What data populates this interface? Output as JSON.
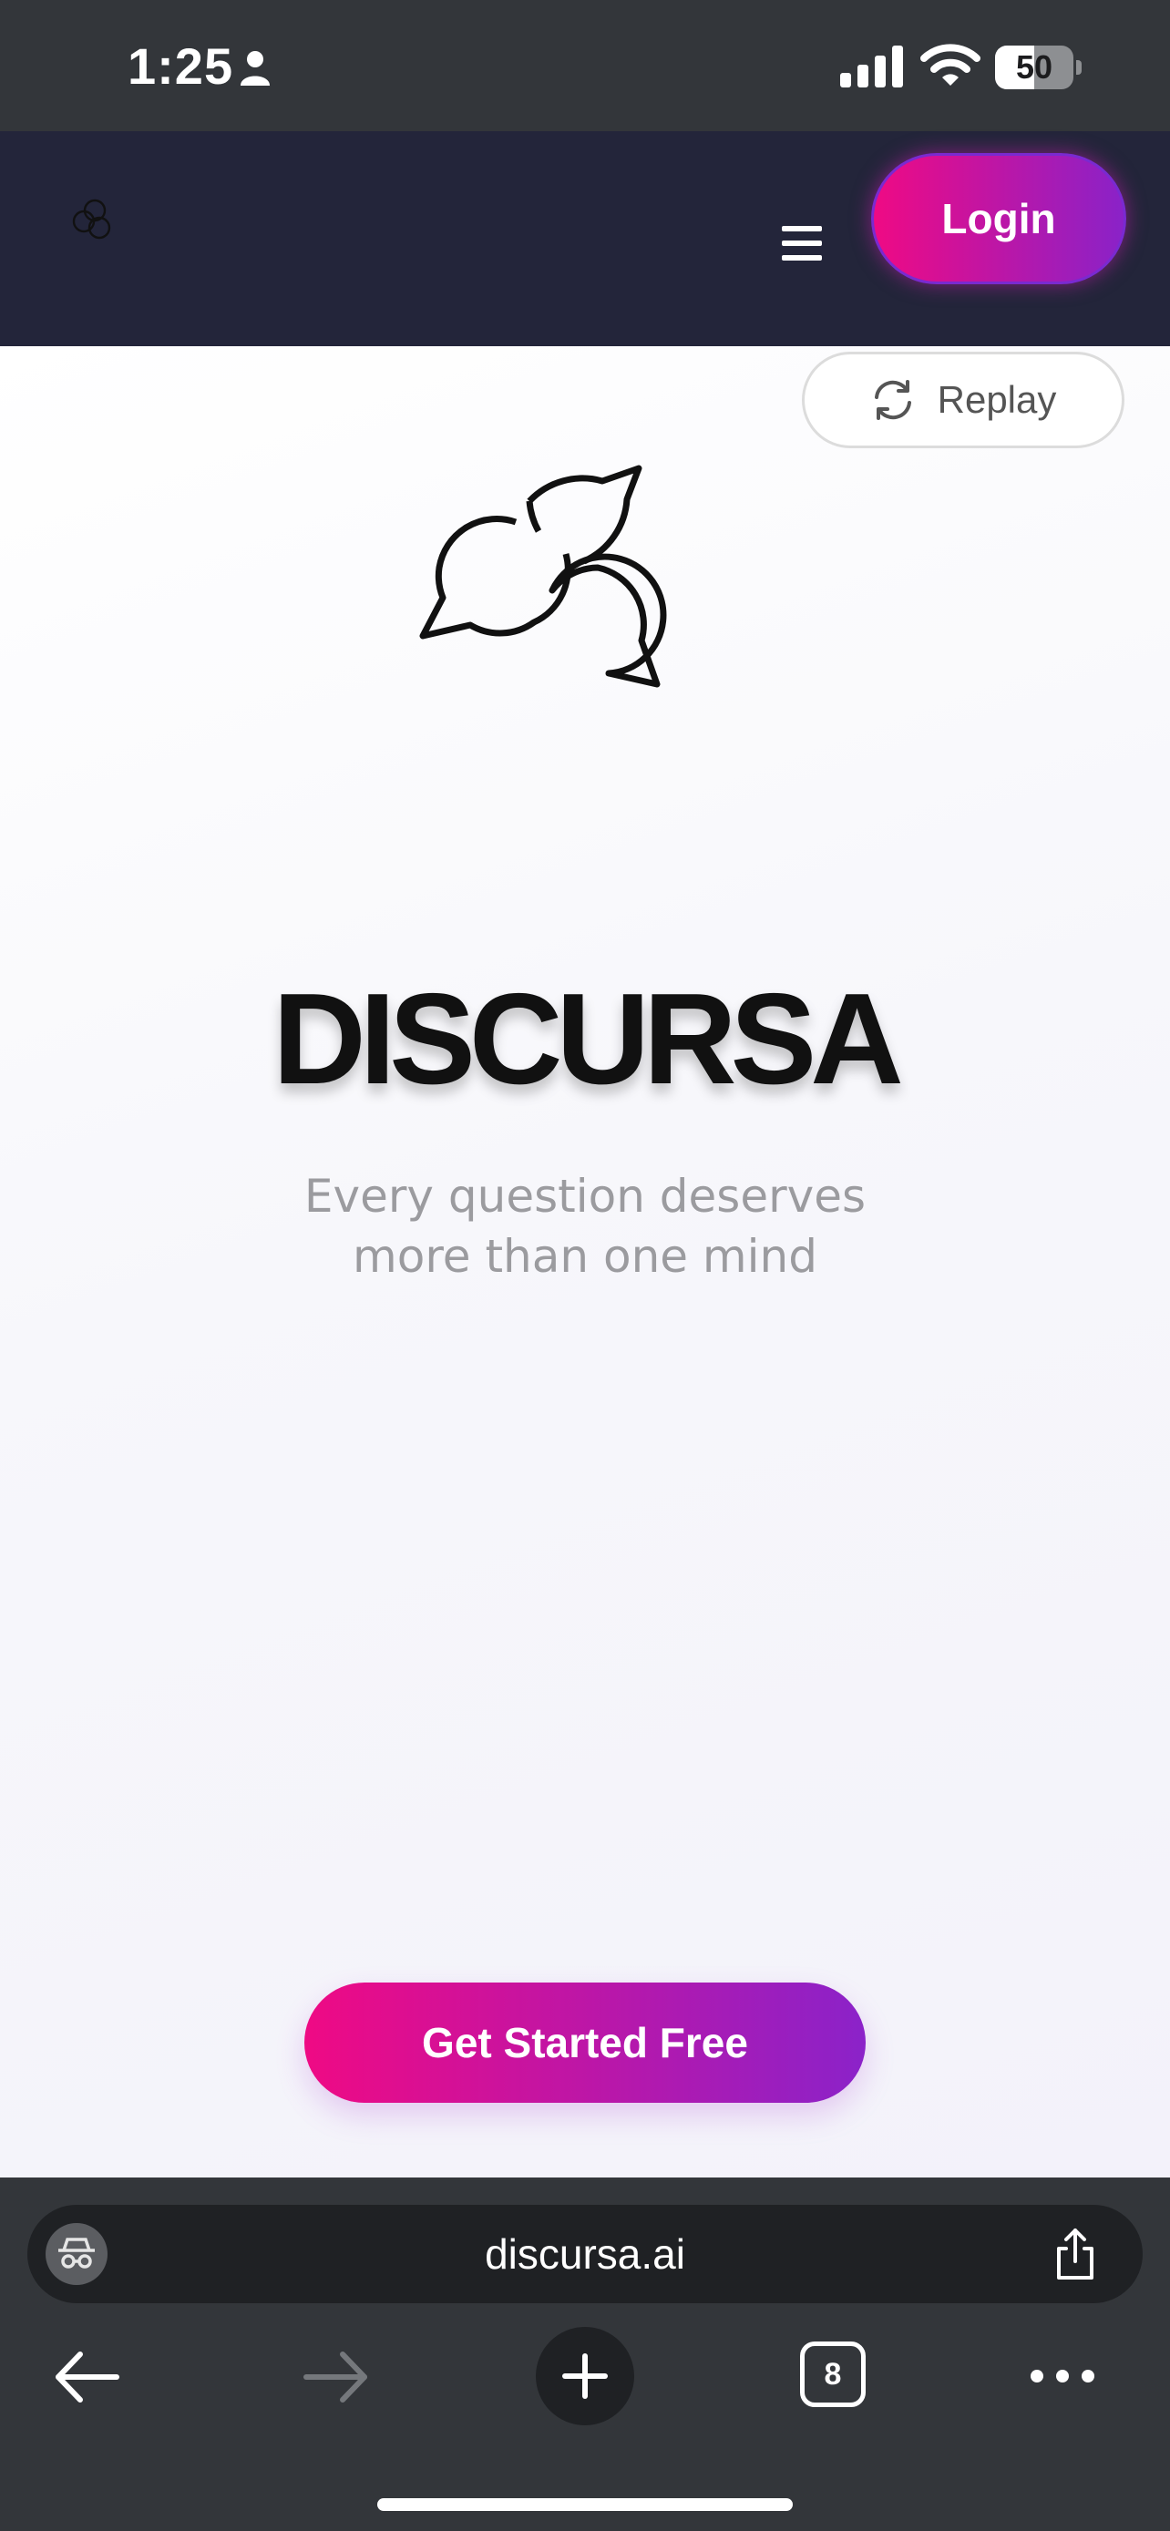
{
  "status_bar": {
    "time": "1:25",
    "battery_level": "50",
    "battery_fraction": 0.5
  },
  "header": {
    "login_label": "Login"
  },
  "hero": {
    "replay_label": "Replay",
    "title": "DISCURSA",
    "tagline": "Every question deserves more than one mind",
    "cta_label": "Get Started Free"
  },
  "browser": {
    "url": "discursa.ai",
    "tab_count": "8"
  },
  "icons": {
    "status": [
      "person-icon",
      "signal-icon",
      "wifi-icon",
      "battery-icon"
    ],
    "header": [
      "logo-icon",
      "hamburger-menu-icon"
    ],
    "browser": [
      "incognito-icon",
      "share-icon",
      "back-arrow-icon",
      "forward-arrow-icon",
      "plus-icon",
      "more-icon"
    ]
  },
  "colors": {
    "gradient_start": "#ef0a84",
    "gradient_end": "#8a22c8",
    "header_bg": "#23253a",
    "browser_bg": "#33363a"
  }
}
